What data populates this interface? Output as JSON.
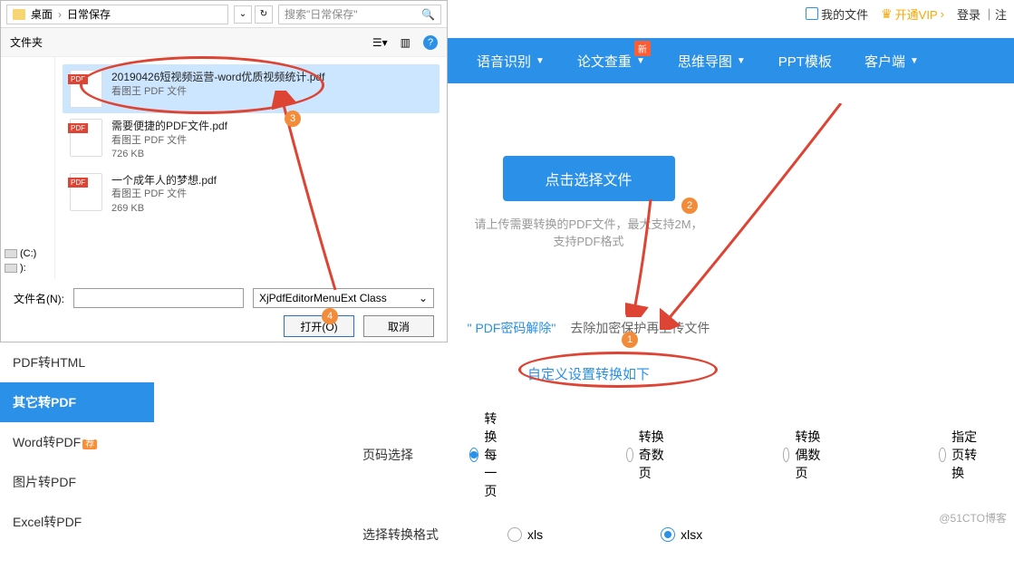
{
  "header": {
    "my_files": "我的文件",
    "vip": "开通VIP",
    "login": "登录",
    "reg_sep": "｜注"
  },
  "nav": {
    "items": [
      {
        "label": "语音识别"
      },
      {
        "label": "论文查重",
        "badge": "新"
      },
      {
        "label": "思维导图"
      },
      {
        "label": "PPT模板"
      },
      {
        "label": "客户端"
      }
    ]
  },
  "dialog": {
    "path": {
      "p1": "桌面",
      "p2": "日常保存"
    },
    "search_ph": "搜索\"日常保存\"",
    "new_folder": "文件夹",
    "files": [
      {
        "name": "20190426短视频运营-word优质视频统计.pdf",
        "type": "看图王 PDF 文件",
        "size": ""
      },
      {
        "name": "需要便捷的PDF文件.pdf",
        "type": "看图王 PDF 文件",
        "size": "726 KB"
      },
      {
        "name": "一个成年人的梦想.pdf",
        "type": "看图王 PDF 文件",
        "size": "269 KB"
      }
    ],
    "drives": {
      "c": "(C:)",
      "d": "):"
    },
    "fname_label": "文件名(N):",
    "type_value": "XjPdfEditorMenuExt Class",
    "open": "打开(O)",
    "cancel": "取消"
  },
  "main": {
    "upload_btn": "点击选择文件",
    "hint_l1": "请上传需要转换的PDF文件，最大支持2M，",
    "hint_l2": "支持PDF格式",
    "pwd_link": "\" PDF密码解除\"",
    "pwd_txt": "去除加密保护再上传文件",
    "custom_title": "自定义设置转换如下"
  },
  "opts": {
    "page_sel": "页码选择",
    "page_choices": [
      "转换每一页",
      "转换奇数页",
      "转换偶数页",
      "指定页转换"
    ],
    "fmt_sel": "选择转换格式",
    "fmt_choices": [
      "xls",
      "xlsx"
    ]
  },
  "sidebar": {
    "items": [
      {
        "label": "PDF转HTML"
      },
      {
        "label": "其它转PDF",
        "active": true
      },
      {
        "label": "Word转PDF",
        "badge": "荐"
      },
      {
        "label": "图片转PDF"
      },
      {
        "label": "Excel转PDF"
      }
    ]
  },
  "watermark": "@51CTO博客",
  "annotations": {
    "n1": "1",
    "n2": "2",
    "n3": "3",
    "n4": "4"
  }
}
